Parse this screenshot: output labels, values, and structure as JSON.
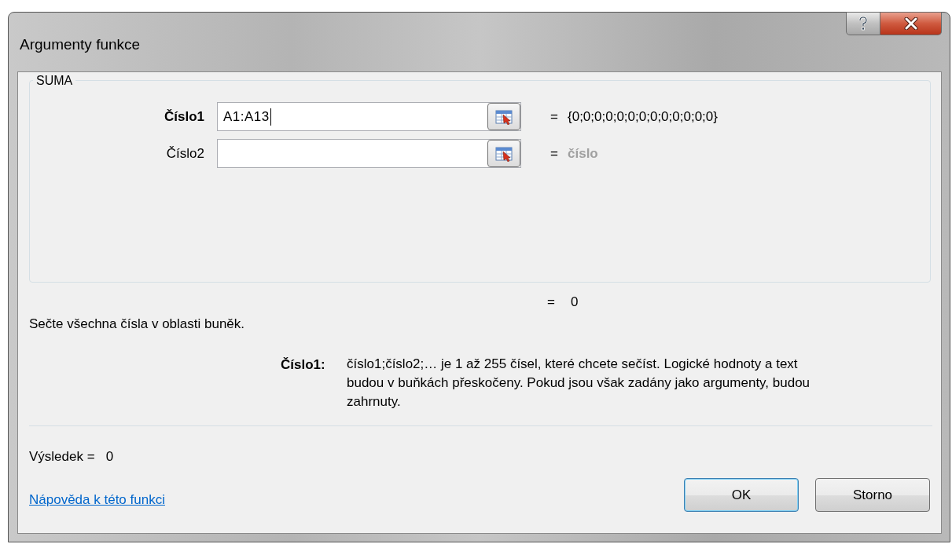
{
  "window": {
    "title": "Argumenty funkce"
  },
  "function": {
    "name": "SUMA",
    "arguments": [
      {
        "label": "Číslo1",
        "value": "A1:A13",
        "selected": true,
        "equals": "=",
        "result": "{0;0;0;0;0;0;0;0;0;0;0;0;0}",
        "result_hint": false
      },
      {
        "label": "Číslo2",
        "selected": false,
        "equals": "=",
        "result": "číslo",
        "result_hint": true
      }
    ],
    "formula_result": {
      "equals": "=",
      "value": "0"
    }
  },
  "description": "Sečte všechna čísla v oblasti buněk.",
  "argument_help": {
    "label": "Číslo1:",
    "text": "číslo1;číslo2;… je 1 až 255 čísel, které chcete sečíst. Logické hodnoty a text budou v buňkách přeskočeny. Pokud jsou však zadány jako argumenty, budou zahrnuty."
  },
  "result": {
    "label": "Výsledek =",
    "value": "0"
  },
  "help_link": "Nápověda k této funkci",
  "buttons": [
    {
      "label": "OK",
      "default": true
    },
    {
      "label": "Storno",
      "default": false
    }
  ]
}
